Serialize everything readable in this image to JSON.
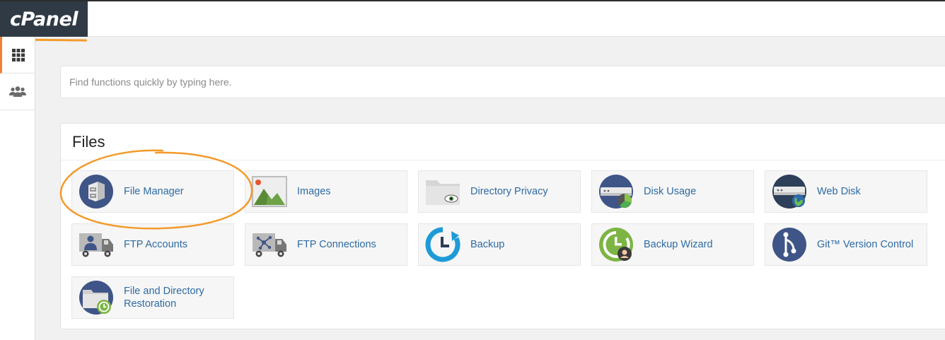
{
  "header": {
    "logo_text": "cPanel"
  },
  "sidebar": {
    "items": [
      {
        "icon": "grid-icon",
        "active": true
      },
      {
        "icon": "users-icon",
        "active": false
      }
    ]
  },
  "search": {
    "placeholder": "Find functions quickly by typing here."
  },
  "files_section": {
    "title": "Files",
    "items": [
      {
        "label": "File Manager",
        "icon": "file-manager-icon"
      },
      {
        "label": "Images",
        "icon": "images-icon"
      },
      {
        "label": "Directory Privacy",
        "icon": "directory-privacy-icon"
      },
      {
        "label": "Disk Usage",
        "icon": "disk-usage-icon"
      },
      {
        "label": "Web Disk",
        "icon": "web-disk-icon"
      },
      {
        "label": "FTP Accounts",
        "icon": "ftp-accounts-icon"
      },
      {
        "label": "FTP Connections",
        "icon": "ftp-connections-icon"
      },
      {
        "label": "Backup",
        "icon": "backup-icon"
      },
      {
        "label": "Backup Wizard",
        "icon": "backup-wizard-icon"
      },
      {
        "label": "Git™ Version Control",
        "icon": "git-icon"
      },
      {
        "label": "File and Directory Restoration",
        "icon": "restoration-icon"
      }
    ]
  },
  "colors": {
    "accent": "#f08033",
    "link": "#2e6ba3",
    "header_bg": "#2f3a44",
    "annotation": "#f39a2a"
  }
}
